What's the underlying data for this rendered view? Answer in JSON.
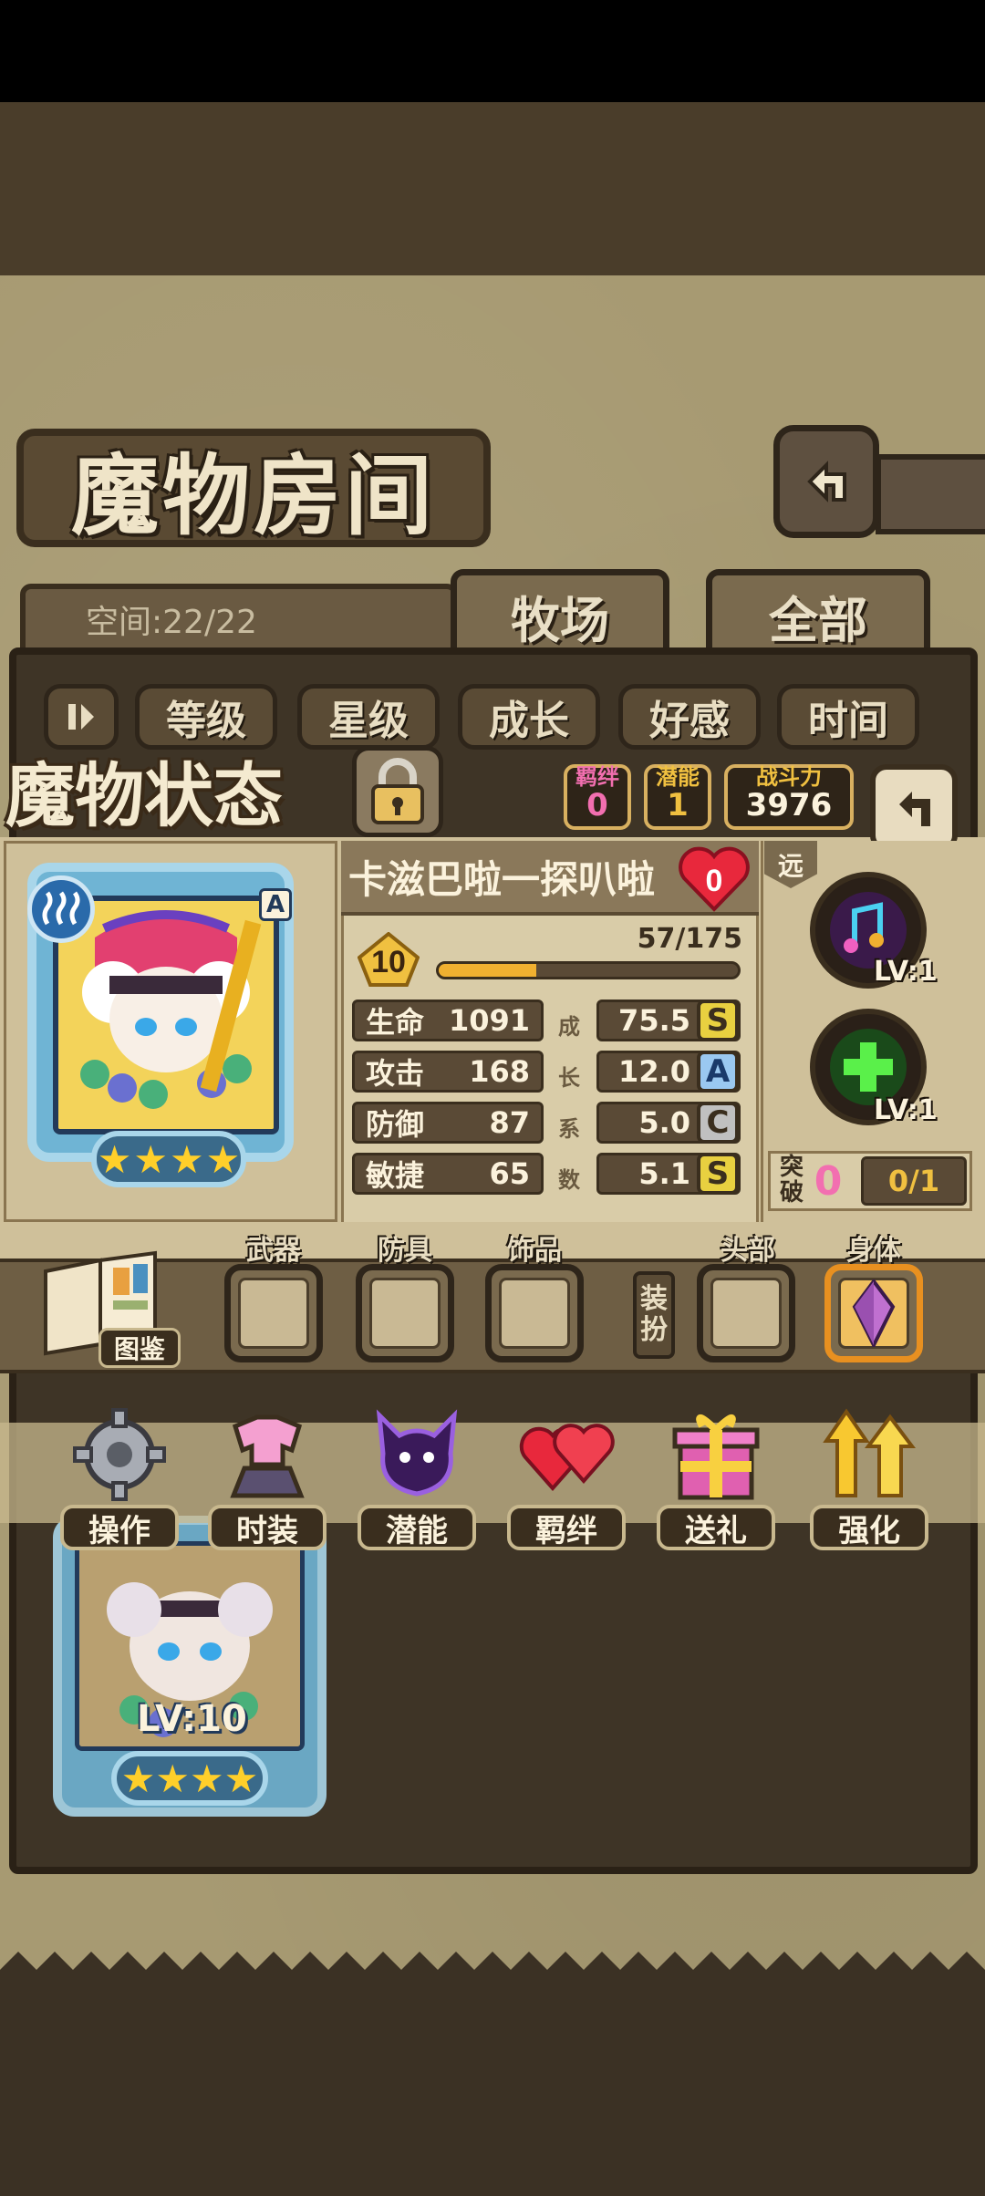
{
  "header": {
    "title": "魔物房间"
  },
  "space": {
    "label": "空间:22/22"
  },
  "tabs": [
    {
      "label": "牧场"
    },
    {
      "label": "全部"
    }
  ],
  "sort_buttons": [
    {
      "label": "等级"
    },
    {
      "label": "星级"
    },
    {
      "label": "成长"
    },
    {
      "label": "好感"
    },
    {
      "label": "时间"
    }
  ],
  "status": {
    "title": "魔物状态",
    "bond": {
      "label": "羁绊",
      "value": "0"
    },
    "potential": {
      "label": "潜能",
      "value": "1"
    },
    "power": {
      "label": "战斗力",
      "value": "3976"
    }
  },
  "monster": {
    "name": "卡滋巴啦一探叭啦",
    "affection": "0",
    "rank": "A",
    "stars": 4,
    "level": "10",
    "exp_text": "57/175",
    "exp_fraction": 0.326,
    "stats": [
      {
        "label": "生命",
        "value": "1091",
        "growth": "75.5",
        "grade": "S"
      },
      {
        "label": "攻击",
        "value": "168",
        "growth": "12.0",
        "grade": "A"
      },
      {
        "label": "防御",
        "value": "87",
        "growth": "5.0",
        "grade": "C"
      },
      {
        "label": "敏捷",
        "value": "65",
        "growth": "5.1",
        "grade": "S"
      }
    ],
    "growth_label": [
      "成",
      "长",
      "系",
      "数"
    ]
  },
  "skills": {
    "range": "远",
    "items": [
      {
        "icon": "music-note-icon",
        "level": "LV:1"
      },
      {
        "icon": "heal-cross-icon",
        "level": "LV:1"
      }
    ],
    "breakthrough": {
      "label_top": "突",
      "label_bottom": "破",
      "count": "0",
      "progress": "0/1"
    }
  },
  "equipment": {
    "book_label": "图鉴",
    "slots": [
      {
        "label": "武器"
      },
      {
        "label": "防具"
      },
      {
        "label": "饰品"
      }
    ],
    "dress_label": "装扮",
    "dress_slots": [
      {
        "label": "头部"
      },
      {
        "label": "身体"
      }
    ]
  },
  "actions": [
    {
      "label": "操作",
      "icon": "gear-icon"
    },
    {
      "label": "时装",
      "icon": "outfit-icon"
    },
    {
      "label": "潜能",
      "icon": "shadow-demon-icon"
    },
    {
      "label": "羁绊",
      "icon": "hearts-icon"
    },
    {
      "label": "送礼",
      "icon": "gift-icon"
    },
    {
      "label": "强化",
      "icon": "upgrade-arrows-icon"
    }
  ],
  "list_card": {
    "level": "LV:10",
    "stars": 4
  },
  "colors": {
    "gold": "#f0b030",
    "pink": "#f26fb0",
    "grade_S": "#e8d040",
    "grade_A": "#9ac8f0",
    "grade_C": "#c0c0c0"
  }
}
